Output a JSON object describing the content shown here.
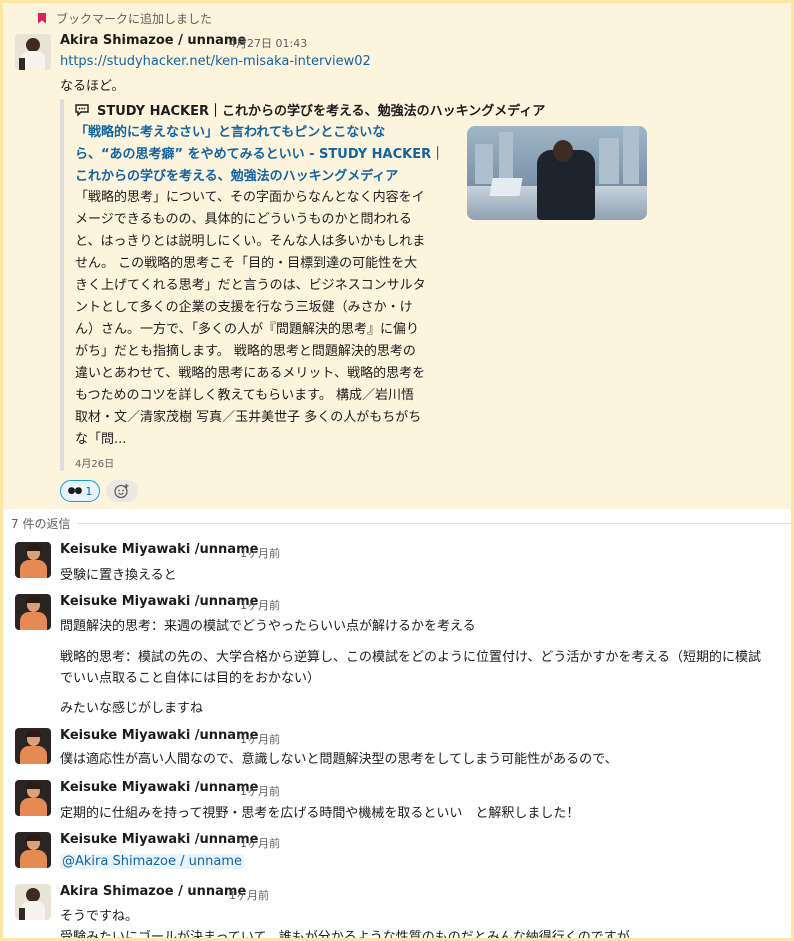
{
  "parent": {
    "bookmark_text": "ブックマークに追加しました",
    "author": "Akira Shimazoe / unname",
    "timestamp": "4月27日 01:43",
    "link": "https://studyhacker.net/ken-misaka-interview02",
    "text": "なるほど。",
    "unfurl": {
      "site": "STUDY HACKER｜これからの学びを考える、勉強法のハッキングメディア",
      "title_lines": [
        "「戦略的に考えなさい」と言われてもピンとこないな",
        "ら、“あの思考癖” をやめてみるといい - STUDY HACKER｜",
        "これからの学びを考える、勉強法のハッキングメディア"
      ],
      "desc_lines": [
        "「戦略的思考」について、その字面からなんとなく内容をイ",
        "メージできるものの、具体的にどういうものかと問われる",
        "と、はっきりとは説明しにくい。そんな人は多いかもしれま",
        "せん。 この戦略的思考こそ「目的・目標到達の可能性を大",
        "きく上げてくれる思考」だと言うのは、ビジネスコンサルタ",
        "ントとして多くの企業の支援を行なう三坂健（みさか・け",
        "ん）さん。一方で、「多くの人が『問題解決的思考』に偏り",
        "がち」だとも指摘します。 戦略的思考と問題解決的思考の",
        "違いとあわせて、戦略的思考にあるメリット、戦略的思考を",
        "もつためのコツを詳しく教えてもらいます。 構成／岩川悟",
        "取材・文／清家茂樹 写真／玉井美世子 多くの人がもちがち",
        "な「問..."
      ],
      "date": "4月26日",
      "image_icon": "office-window-man-photo"
    },
    "reactions": {
      "eyes_count": "1",
      "eyes_icon": "eyes-emoji",
      "add_icon": "add-reaction-icon"
    }
  },
  "replies_label": "7 件の返信",
  "messages": [
    {
      "author": "Keisuke Miyawaki /unname",
      "ts": "1ヶ月前",
      "lines": [
        "受験に置き換えると"
      ]
    },
    {
      "author": "Keisuke Miyawaki /unname",
      "ts": "1ヶ月前",
      "lines": [
        "問題解決的思考：来週の模試でどうやったらいい点が解けるかを考える",
        "戦略的思考：模試の先の、大学合格から逆算し、この模試をどのように位置付け、どう活かすかを考える（短期的に模試",
        "でいい点取ること自体には目的をおかない）",
        "みたいな感じがしますね"
      ]
    },
    {
      "author": "Keisuke Miyawaki /unname",
      "ts": "1ヶ月前",
      "lines": [
        "僕は適応性が高い人間なので、意識しないと問題解決型の思考をしてしまう可能性があるので、"
      ]
    },
    {
      "author": "Keisuke Miyawaki /unname",
      "ts": "1ヶ月前",
      "lines": [
        "定期的に仕組みを持って視野・思考を広げる時間や機械を取るといい　と解釈しました！"
      ]
    },
    {
      "author": "Keisuke Miyawaki /unname",
      "ts": "1ヶ月前",
      "mention": "@Akira Shimazoe / unname"
    },
    {
      "author": "Akira Shimazoe / unname",
      "ts": "1ヶ月前",
      "lines": [
        "そうですね。",
        "受験みたいにゴールが決まっていて、誰もが分かるような性質のものだとみんな納得行くのですが、"
      ]
    }
  ],
  "colors": {
    "highlight_bg": "#fcf4dc",
    "link": "#1264a3",
    "bookmark": "#e01e5a",
    "frame": "#fbe7a1"
  }
}
